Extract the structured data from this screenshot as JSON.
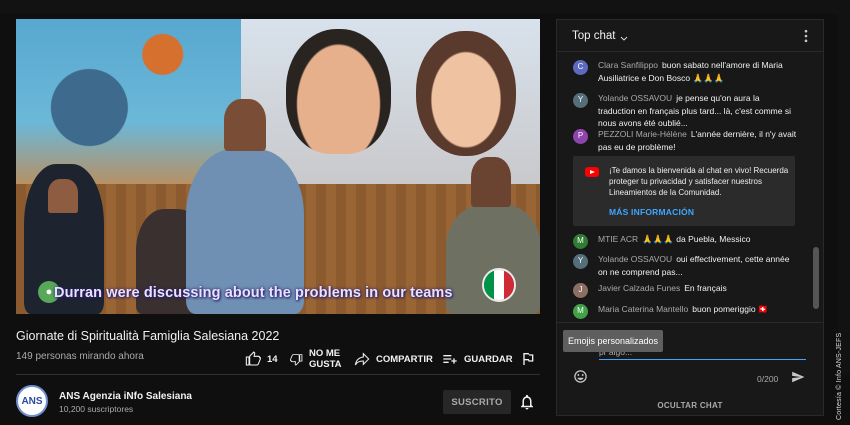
{
  "video": {
    "subtitle": "Durran were discussing about the problems in our teams",
    "title": "Giornate di Spiritualità Famiglia Salesiana 2022",
    "views": "149 personas mirando ahora"
  },
  "actions": {
    "like_count": "14",
    "dislike_label_1": "NO ME",
    "dislike_label_2": "GUSTA",
    "share_label": "COMPARTIR",
    "save_label": "GUARDAR"
  },
  "channel": {
    "avatar_text": "ANS",
    "name": "ANS Agenzia iNfo Salesiana",
    "subscribers": "10,200 suscriptores",
    "subscribe_label": "SUSCRITO"
  },
  "chat": {
    "header": "Top chat",
    "messages": [
      {
        "initial": "C",
        "color": "#5c6bc0",
        "author": "Clara Sanfilippo",
        "text": "buon sabato nell'amore di Maria Ausiliatrice e Don Bosco 🙏🙏🙏"
      },
      {
        "initial": "Y",
        "color": "#546e7a",
        "author": "Yolande OSSAVOU",
        "text": "je pense qu'on aura la traduction en français plus tard... là, c'est comme si nous avons été oublié..."
      },
      {
        "initial": "P",
        "color": "#8e44ad",
        "author": "PEZZOLI Marie-Hélène",
        "text": "L'année dernière, il n'y avait pas eu de problème!"
      },
      {
        "initial": "M",
        "color": "#2e7d32",
        "author": "MTIE ACR",
        "text": "🙏🙏🙏 da Puebla, Messico"
      },
      {
        "initial": "Y",
        "color": "#546e7a",
        "author": "Yolande OSSAVOU",
        "text": "oui effectivement, cette année on ne comprend pas..."
      },
      {
        "initial": "J",
        "color": "#8d6e63",
        "author": "Javier Calzada Funes",
        "text": "En français"
      },
      {
        "initial": "M",
        "color": "#43a047",
        "author": "Maria Caterina Mantello",
        "text": "buon pomeriggio 🇨🇭"
      }
    ],
    "notice_text": "¡Te damos la bienvenida al chat en vivo! Recuerda proteger tu privacidad y satisfacer nuestros Lineamientos de la Comunidad.",
    "notice_link": "MÁS INFORMACIÓN",
    "tooltip": "Emojis personalizados",
    "input_text": "pr algo...",
    "counter": "0/200",
    "hide_label": "OCULTAR CHAT"
  },
  "credit": "Cortesía © Info ANS-JEFS",
  "colors": {
    "background": "#0f0f0f",
    "link": "#3ea6ff",
    "youtube_red": "#ff0000"
  }
}
